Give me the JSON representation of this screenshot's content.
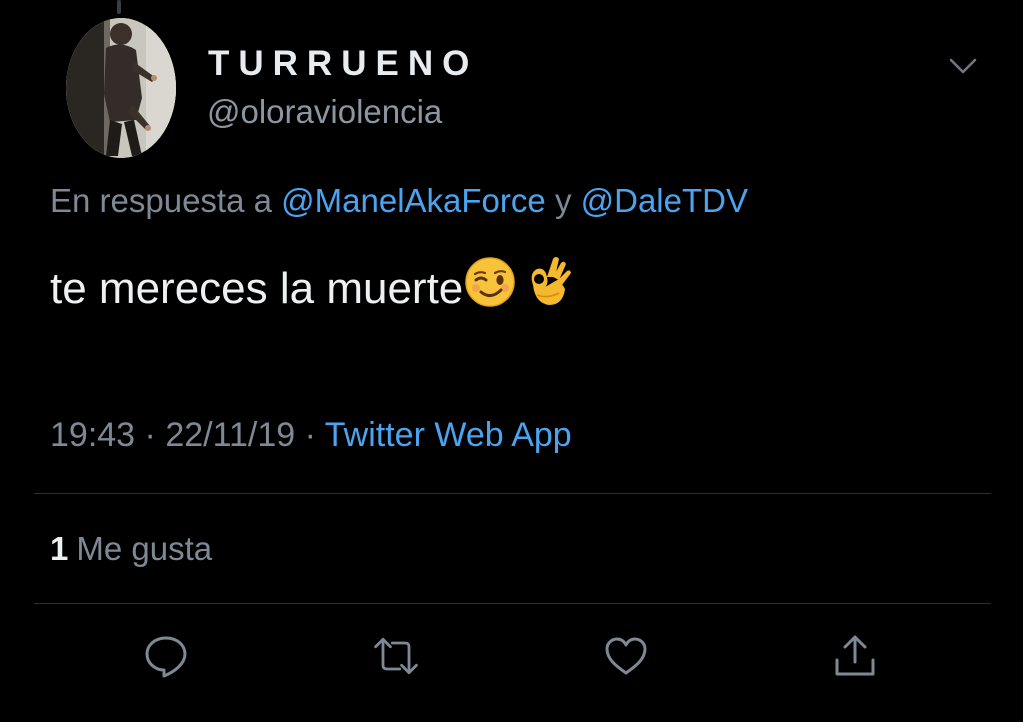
{
  "user": {
    "display_name": "TURRUENO",
    "handle": "@oloraviolencia",
    "avatar": "user-avatar-photo"
  },
  "reply_context": {
    "prefix": "En respuesta a",
    "mention_1": "@ManelAkaForce",
    "joiner": "y",
    "mention_2": "@DaleTDV"
  },
  "tweet": {
    "text": "te mereces la muerte",
    "emojis": [
      "winking-face-emoji",
      "ok-hand-emoji"
    ]
  },
  "meta": {
    "time": "19:43",
    "separator": "·",
    "date": "22/11/19",
    "source": "Twitter Web App"
  },
  "stats": {
    "likes_count": "1",
    "likes_label": "Me gusta"
  },
  "actions": [
    "reply-icon",
    "retweet-icon",
    "like-icon",
    "share-icon"
  ],
  "colors": {
    "background": "#000000",
    "link": "#4aa4ef",
    "muted": "#7d8995",
    "text": "#eef0f1"
  }
}
